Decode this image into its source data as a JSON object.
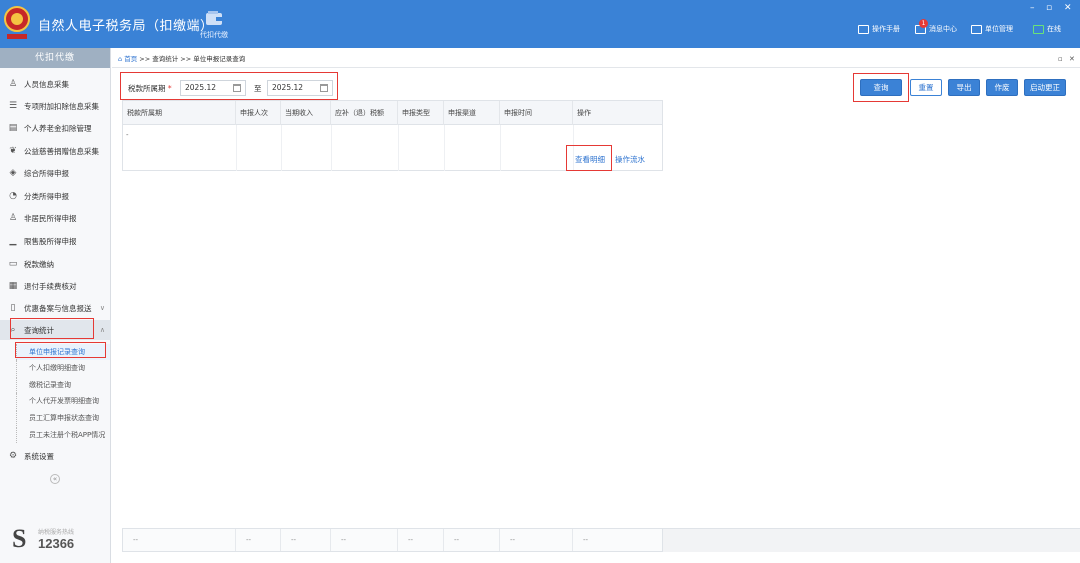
{
  "app": {
    "title": "自然人电子税务局（扣缴端）",
    "top_nav_item": "代扣代缴",
    "top_right": {
      "manual": "操作手册",
      "messages": "消息中心",
      "messages_count": "1",
      "unit": "单位管理",
      "online": "在线"
    },
    "window_controls": [
      "–",
      "▫",
      "✕"
    ]
  },
  "sidebar": {
    "header": "代扣代缴",
    "items": [
      {
        "label": "人员信息采集",
        "icon": "person-icon"
      },
      {
        "label": "专项附加扣除信息采集",
        "icon": "list-icon"
      },
      {
        "label": "个人养老金扣除管理",
        "icon": "document-icon"
      },
      {
        "label": "公益慈善捐赠信息采集",
        "icon": "donation-icon"
      },
      {
        "label": "综合所得申报",
        "icon": "stack-icon"
      },
      {
        "label": "分类所得申报",
        "icon": "pie-icon"
      },
      {
        "label": "非居民所得申报",
        "icon": "person-outline-icon"
      },
      {
        "label": "限售股所得申报",
        "icon": "chart-icon"
      },
      {
        "label": "税款缴纳",
        "icon": "folder-icon"
      },
      {
        "label": "退付手续费核对",
        "icon": "ledger-icon"
      },
      {
        "label": "优惠备案与信息报送",
        "icon": "file-icon"
      },
      {
        "label": "查询统计",
        "icon": "search-doc-icon"
      }
    ],
    "sub_items": [
      "单位申报记录查询",
      "个人扣缴明细查询",
      "缴税记录查询",
      "个人代开发票明细查询",
      "员工汇算申报状态查询",
      "员工未注册个税APP情况"
    ],
    "settings": "系统设置",
    "collapse": "«",
    "hotline_label": "纳税服务热线",
    "hotline_number": "12366",
    "hotline_logo": "S"
  },
  "breadcrumb": {
    "home": "首页",
    "sep": " >> ",
    "level1": "查询统计",
    "level2": "单位申报记录查询",
    "pin": "▫",
    "close": "✕"
  },
  "filter": {
    "label": "税款所属期",
    "required_mark": "*",
    "start": "2025.12",
    "to": "至",
    "end": "2025.12"
  },
  "buttons": {
    "query": "查询",
    "reset": "重置",
    "export": "导出",
    "void": "作废",
    "correct": "启动更正"
  },
  "table": {
    "columns": [
      "税款所属期",
      "申报人次",
      "当期收入",
      "应补（退）税额",
      "申报类型",
      "申报渠道",
      "申报时间",
      "操作"
    ],
    "row_placeholder": "-",
    "actions": [
      "查看明细",
      "操作流水"
    ],
    "footer": [
      "--",
      "--",
      "--",
      "--",
      "--",
      "--",
      "--",
      "--"
    ]
  },
  "colors": {
    "titlebar": "#3a82d6",
    "accent": "#2f74d0",
    "highlight": "#e53935"
  }
}
